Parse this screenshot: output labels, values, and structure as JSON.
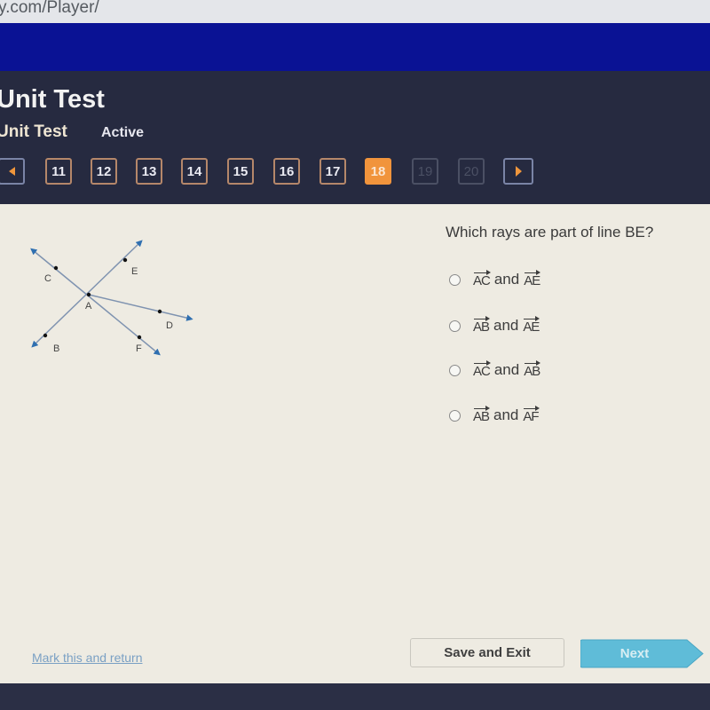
{
  "browser": {
    "url_text": "y.com/Player/"
  },
  "header": {
    "title": "Unit Test",
    "subtitle": "Unit Test",
    "status": "Active"
  },
  "nav": {
    "prev_icon": "triangle-left-icon",
    "next_icon": "triangle-right-icon",
    "questions": [
      {
        "label": "11",
        "state": "answered"
      },
      {
        "label": "12",
        "state": "answered"
      },
      {
        "label": "13",
        "state": "answered"
      },
      {
        "label": "14",
        "state": "answered"
      },
      {
        "label": "15",
        "state": "answered"
      },
      {
        "label": "16",
        "state": "answered"
      },
      {
        "label": "17",
        "state": "answered"
      },
      {
        "label": "18",
        "state": "current"
      },
      {
        "label": "19",
        "state": "disabled"
      },
      {
        "label": "20",
        "state": "disabled"
      }
    ],
    "accent_color": "#f1943c"
  },
  "figure": {
    "points": [
      "A",
      "B",
      "C",
      "D",
      "E",
      "F"
    ],
    "lines": [
      "line BE",
      "line CF",
      "ray AD"
    ],
    "labels": {
      "A": "A",
      "B": "B",
      "C": "C",
      "D": "D",
      "E": "E",
      "F": "F"
    }
  },
  "question": {
    "text": "Which rays are part of line BE?",
    "choices": [
      {
        "ray1": "AC",
        "conj": "and",
        "ray2": "AE"
      },
      {
        "ray1": "AB",
        "conj": "and",
        "ray2": "AE"
      },
      {
        "ray1": "AC",
        "conj": "and",
        "ray2": "AB"
      },
      {
        "ray1": "AB",
        "conj": "and",
        "ray2": "AF"
      }
    ]
  },
  "footer": {
    "mark_link": "Mark this and return",
    "save_exit": "Save and Exit",
    "next": "Next"
  }
}
